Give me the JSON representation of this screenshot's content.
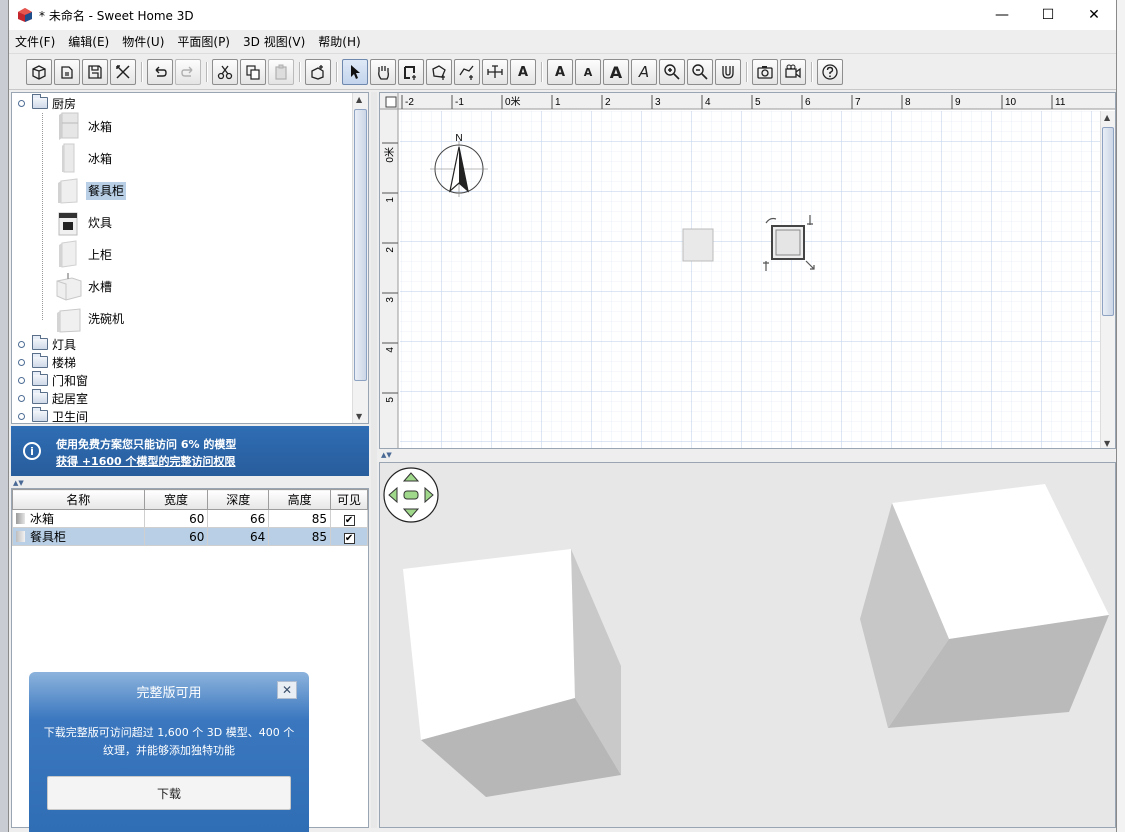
{
  "window": {
    "title": "* 未命名 - Sweet Home 3D"
  },
  "menubar": [
    "文件(F)",
    "编辑(E)",
    "物件(U)",
    "平面图(P)",
    "3D 视图(V)",
    "帮助(H)"
  ],
  "toolbar": {
    "text_buttons": [
      "A",
      "A",
      "A",
      "A",
      "A",
      "A"
    ]
  },
  "catalog": {
    "category_kitchen": "厨房",
    "items": [
      {
        "label": "冰箱",
        "icon": "fridge-icon"
      },
      {
        "label": "冰箱",
        "icon": "fridge-icon"
      },
      {
        "label": "餐具柜",
        "icon": "cabinet-icon",
        "selected": true
      },
      {
        "label": "炊具",
        "icon": "cooker-icon"
      },
      {
        "label": "上柜",
        "icon": "upper-cabinet-icon"
      },
      {
        "label": "水槽",
        "icon": "sink-icon"
      },
      {
        "label": "洗碗机",
        "icon": "dishwasher-icon"
      }
    ],
    "other_categories": [
      "灯具",
      "楼梯",
      "门和窗",
      "起居室",
      "卫生间"
    ]
  },
  "banner": {
    "line1": "使用免费方案您只能访问 6% 的模型",
    "line2": "获得 +1600 个模型的完整访问权限"
  },
  "furniture_table": {
    "headers": [
      "名称",
      "宽度",
      "深度",
      "高度",
      "可见"
    ],
    "rows": [
      {
        "name": "冰箱",
        "width": "60",
        "depth": "66",
        "height": "85",
        "visible": "✔",
        "selected": false
      },
      {
        "name": "餐具柜",
        "width": "60",
        "depth": "64",
        "height": "85",
        "visible": "✔",
        "selected": true
      }
    ]
  },
  "promo": {
    "title": "完整版可用",
    "close": "✕",
    "body": "下载完整版可访问超过 1,600 个 3D 模型、400 个纹理，并能够添加独特功能",
    "button": "下载"
  },
  "plan": {
    "h_ticks": [
      "-2",
      "-1",
      "0米",
      "1",
      "2",
      "3",
      "4",
      "5",
      "6",
      "7",
      "8",
      "9",
      "10",
      "11"
    ],
    "v_ticks": [
      "0米",
      "1",
      "2",
      "3",
      "4",
      "5"
    ],
    "compass_label": "N"
  },
  "colors": {
    "accent": "#2f6db4",
    "selection": "#b8cfe6",
    "grid": "#c7d9ee"
  }
}
